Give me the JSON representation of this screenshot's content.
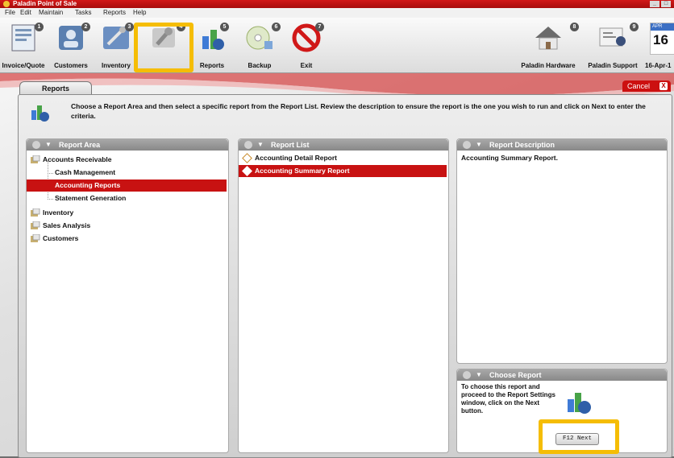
{
  "window": {
    "title": "Paladin Point of Sale",
    "min_label": "_",
    "max_label": "□"
  },
  "menu": [
    "File",
    "Edit",
    "Maintain",
    "Tasks",
    "Reports",
    "Help"
  ],
  "toolbar": {
    "items": [
      {
        "label": "Invoice/Quote",
        "num": "1",
        "icon": "invoice-icon"
      },
      {
        "label": "Customers",
        "num": "2",
        "icon": "customers-icon"
      },
      {
        "label": "Inventory",
        "num": "3",
        "icon": "inventory-icon"
      },
      {
        "label": "",
        "num": "4",
        "icon": "tools-icon"
      },
      {
        "label": "Reports",
        "num": "5",
        "icon": "reports-icon"
      },
      {
        "label": "Backup",
        "num": "6",
        "icon": "backup-icon"
      },
      {
        "label": "Exit",
        "num": "7",
        "icon": "exit-icon"
      }
    ],
    "right_items": [
      {
        "label": "Paladin Hardware",
        "num": "8",
        "icon": "house-icon"
      },
      {
        "label": "Paladin Support",
        "num": "9",
        "icon": "support-icon"
      }
    ],
    "calendar": {
      "month": "APR",
      "day": "16",
      "date_label": "16-Apr-1"
    }
  },
  "tab": {
    "label": "Reports"
  },
  "cancel": {
    "label": "Cancel",
    "x": "X"
  },
  "instructions": "Choose a Report Area and then select a specific report from the Report List. Review the description to ensure the report is the one you wish to run and click on Next to enter the criteria.",
  "report_area": {
    "title": "Report Area",
    "items": [
      {
        "label": "Accounts Receivable",
        "level": 0
      },
      {
        "label": "Cash Management",
        "level": 1
      },
      {
        "label": "Accounting Reports",
        "level": 1,
        "selected": true
      },
      {
        "label": "Statement Generation",
        "level": 1
      },
      {
        "label": "Inventory",
        "level": 0
      },
      {
        "label": "Sales Analysis",
        "level": 0
      },
      {
        "label": "Customers",
        "level": 0
      }
    ]
  },
  "report_list": {
    "title": "Report List",
    "items": [
      {
        "label": "Accounting Detail Report",
        "selected": false
      },
      {
        "label": "Accounting Summary Report",
        "selected": true
      }
    ]
  },
  "report_description": {
    "title": "Report Description",
    "text": "Accounting Summary Report."
  },
  "choose_report": {
    "title": "Choose Report",
    "text": "To choose this report and proceed to the Report Settings window, click on the Next button.",
    "next_label": "F12 Next"
  },
  "colors": {
    "accent": "#c81212",
    "highlight": "#f5bd05",
    "header": "#999999"
  }
}
